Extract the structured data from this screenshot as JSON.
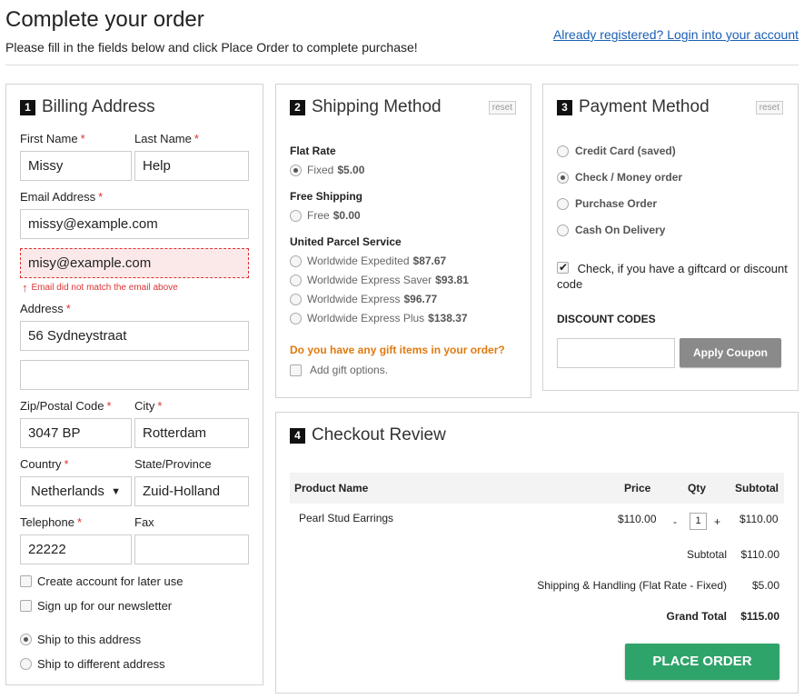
{
  "header": {
    "title": "Complete your order",
    "subtitle": "Please fill in the fields below and click Place Order to complete purchase!",
    "login_link": "Already registered? Login into your account"
  },
  "billing": {
    "step": "1",
    "title": "Billing Address",
    "first_name": {
      "label": "First Name",
      "value": "Missy"
    },
    "last_name": {
      "label": "Last Name",
      "value": "Help"
    },
    "email": {
      "label": "Email Address",
      "value": "missy@example.com"
    },
    "email_confirm": {
      "value": "misy@example.com",
      "error": "Email did not match the email above"
    },
    "address": {
      "label": "Address",
      "line1": "56 Sydneystraat",
      "line2": ""
    },
    "zip": {
      "label": "Zip/Postal Code",
      "value": "3047 BP"
    },
    "city": {
      "label": "City",
      "value": "Rotterdam"
    },
    "country": {
      "label": "Country",
      "value": "Netherlands"
    },
    "state": {
      "label": "State/Province",
      "value": "Zuid-Holland"
    },
    "telephone": {
      "label": "Telephone",
      "value": "22222"
    },
    "fax": {
      "label": "Fax",
      "value": ""
    },
    "create_account": "Create account for later use",
    "newsletter": "Sign up for our newsletter",
    "ship_same": "Ship to this address",
    "ship_different": "Ship to different address"
  },
  "shipping": {
    "step": "2",
    "title": "Shipping Method",
    "reset": "reset",
    "groups": [
      {
        "name": "Flat Rate",
        "options": [
          {
            "label": "Fixed",
            "price": "$5.00",
            "selected": true
          }
        ]
      },
      {
        "name": "Free Shipping",
        "options": [
          {
            "label": "Free",
            "price": "$0.00",
            "selected": false
          }
        ]
      },
      {
        "name": "United Parcel Service",
        "options": [
          {
            "label": "Worldwide Expedited",
            "price": "$87.67",
            "selected": false
          },
          {
            "label": "Worldwide Express Saver",
            "price": "$93.81",
            "selected": false
          },
          {
            "label": "Worldwide Express",
            "price": "$96.77",
            "selected": false
          },
          {
            "label": "Worldwide Express Plus",
            "price": "$138.37",
            "selected": false
          }
        ]
      }
    ],
    "gift_question": "Do you have any gift items in your order?",
    "gift_option": "Add gift options."
  },
  "payment": {
    "step": "3",
    "title": "Payment Method",
    "reset": "reset",
    "options": [
      {
        "label": "Credit Card (saved)",
        "selected": false
      },
      {
        "label": "Check / Money order",
        "selected": true
      },
      {
        "label": "Purchase Order",
        "selected": false
      },
      {
        "label": "Cash On Delivery",
        "selected": false
      }
    ],
    "giftcard_check": "Check, if you have a giftcard or discount code",
    "discount_title": "DISCOUNT CODES",
    "coupon_value": "",
    "apply_coupon": "Apply Coupon"
  },
  "review": {
    "step": "4",
    "title": "Checkout Review",
    "columns": [
      "Product Name",
      "Price",
      "Qty",
      "Subtotal"
    ],
    "items": [
      {
        "name": "Pearl Stud Earrings",
        "price": "$110.00",
        "qty": "1",
        "subtotal": "$110.00"
      }
    ],
    "qty_minus": "-",
    "qty_plus": "+",
    "totals": [
      {
        "label": "Subtotal",
        "value": "$110.00",
        "bold": false
      },
      {
        "label": "Shipping & Handling (Flat Rate - Fixed)",
        "value": "$5.00",
        "bold": false
      },
      {
        "label": "Grand Total",
        "value": "$115.00",
        "bold": true
      }
    ],
    "place_order": "PLACE ORDER"
  },
  "colors": {
    "accent_link": "#1a5fb4",
    "error": "#dd3333",
    "place_order": "#2fa46a",
    "gift_question": "#e07a10"
  }
}
